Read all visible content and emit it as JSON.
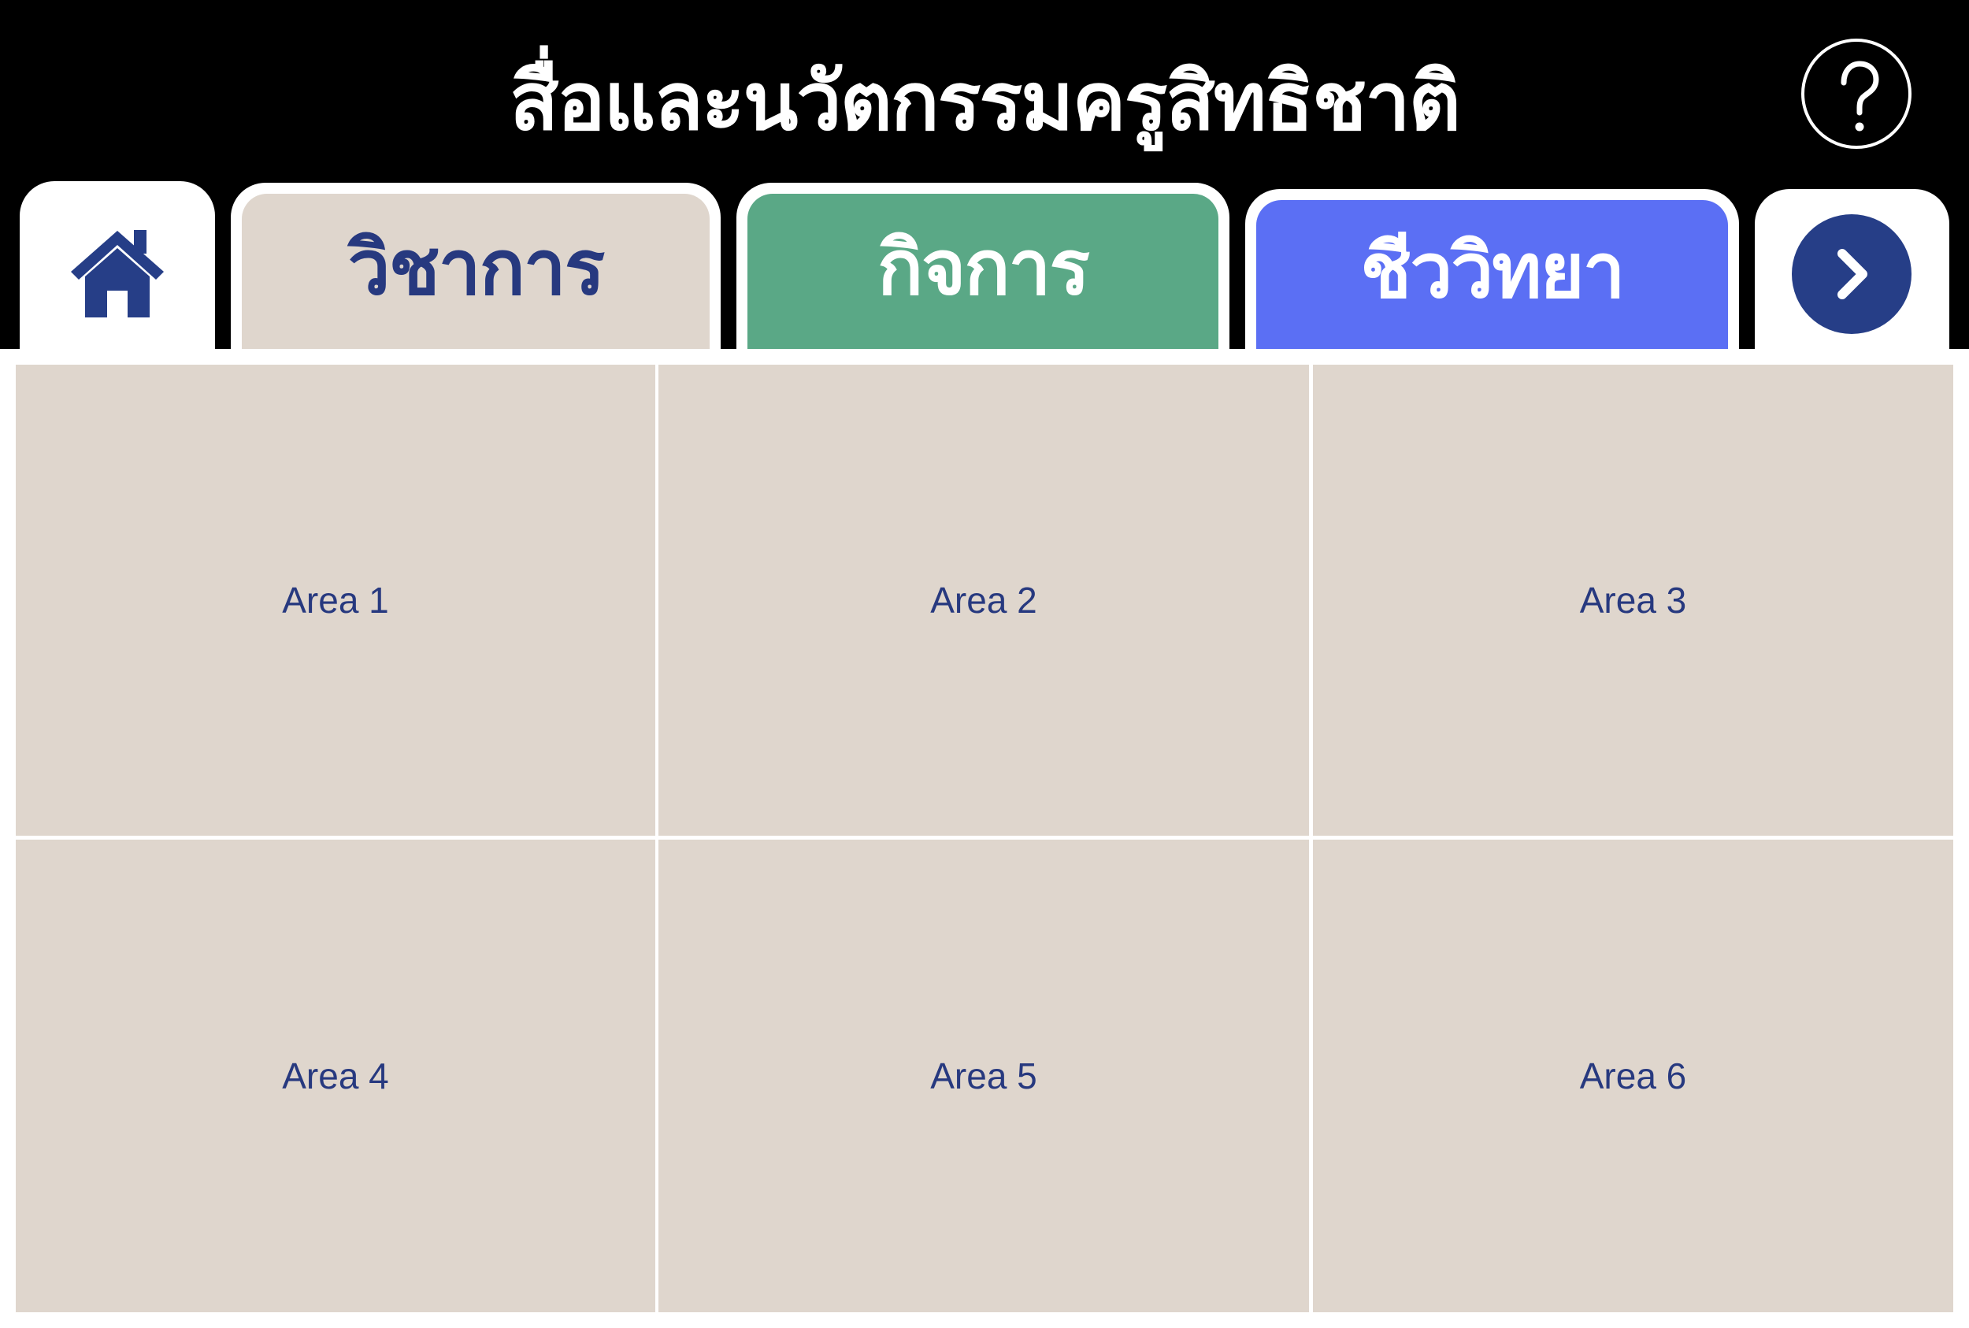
{
  "header": {
    "title": "สื่อและนวัตกรรมครูสิทธิชาติ",
    "help_icon": "question-mark-icon"
  },
  "nav": {
    "home_icon": "home-icon",
    "tabs": [
      {
        "label": "วิชาการ",
        "color": "#dfd6cd",
        "text_color": "#27397f"
      },
      {
        "label": "กิจการ",
        "color": "#5aa886",
        "text_color": "#ffffff"
      },
      {
        "label": "ชีววิทยา",
        "color": "#5b6ff4",
        "text_color": "#ffffff"
      }
    ],
    "next_icon": "chevron-right-icon"
  },
  "areas": [
    {
      "label": "Area 1"
    },
    {
      "label": "Area 2"
    },
    {
      "label": "Area 3"
    },
    {
      "label": "Area 4"
    },
    {
      "label": "Area 5"
    },
    {
      "label": "Area 6"
    }
  ],
  "colors": {
    "header_bg": "#000000",
    "area_bg": "#dfd6cd",
    "accent_navy": "#263e87"
  }
}
